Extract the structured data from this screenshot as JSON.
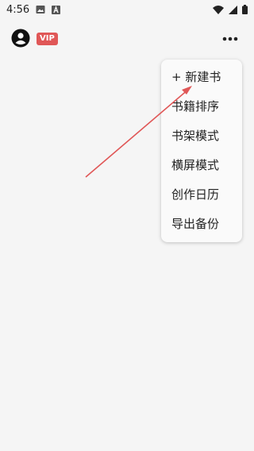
{
  "status_bar": {
    "time": "4:56",
    "icons": [
      "image-icon",
      "a-icon",
      "wifi-icon",
      "signal-icon",
      "battery-icon"
    ]
  },
  "header": {
    "avatar_icon": "account-circle-icon",
    "vip_label": "VIP",
    "vip_color": "#e05757",
    "more_icon": "more-horizontal-icon"
  },
  "menu": {
    "items": [
      {
        "label": "+ 新建书"
      },
      {
        "label": "书籍排序"
      },
      {
        "label": "书架模式"
      },
      {
        "label": "横屏模式"
      },
      {
        "label": "创作日历"
      },
      {
        "label": "导出备份"
      }
    ]
  },
  "annotation": {
    "arrow_color": "#e05757"
  }
}
